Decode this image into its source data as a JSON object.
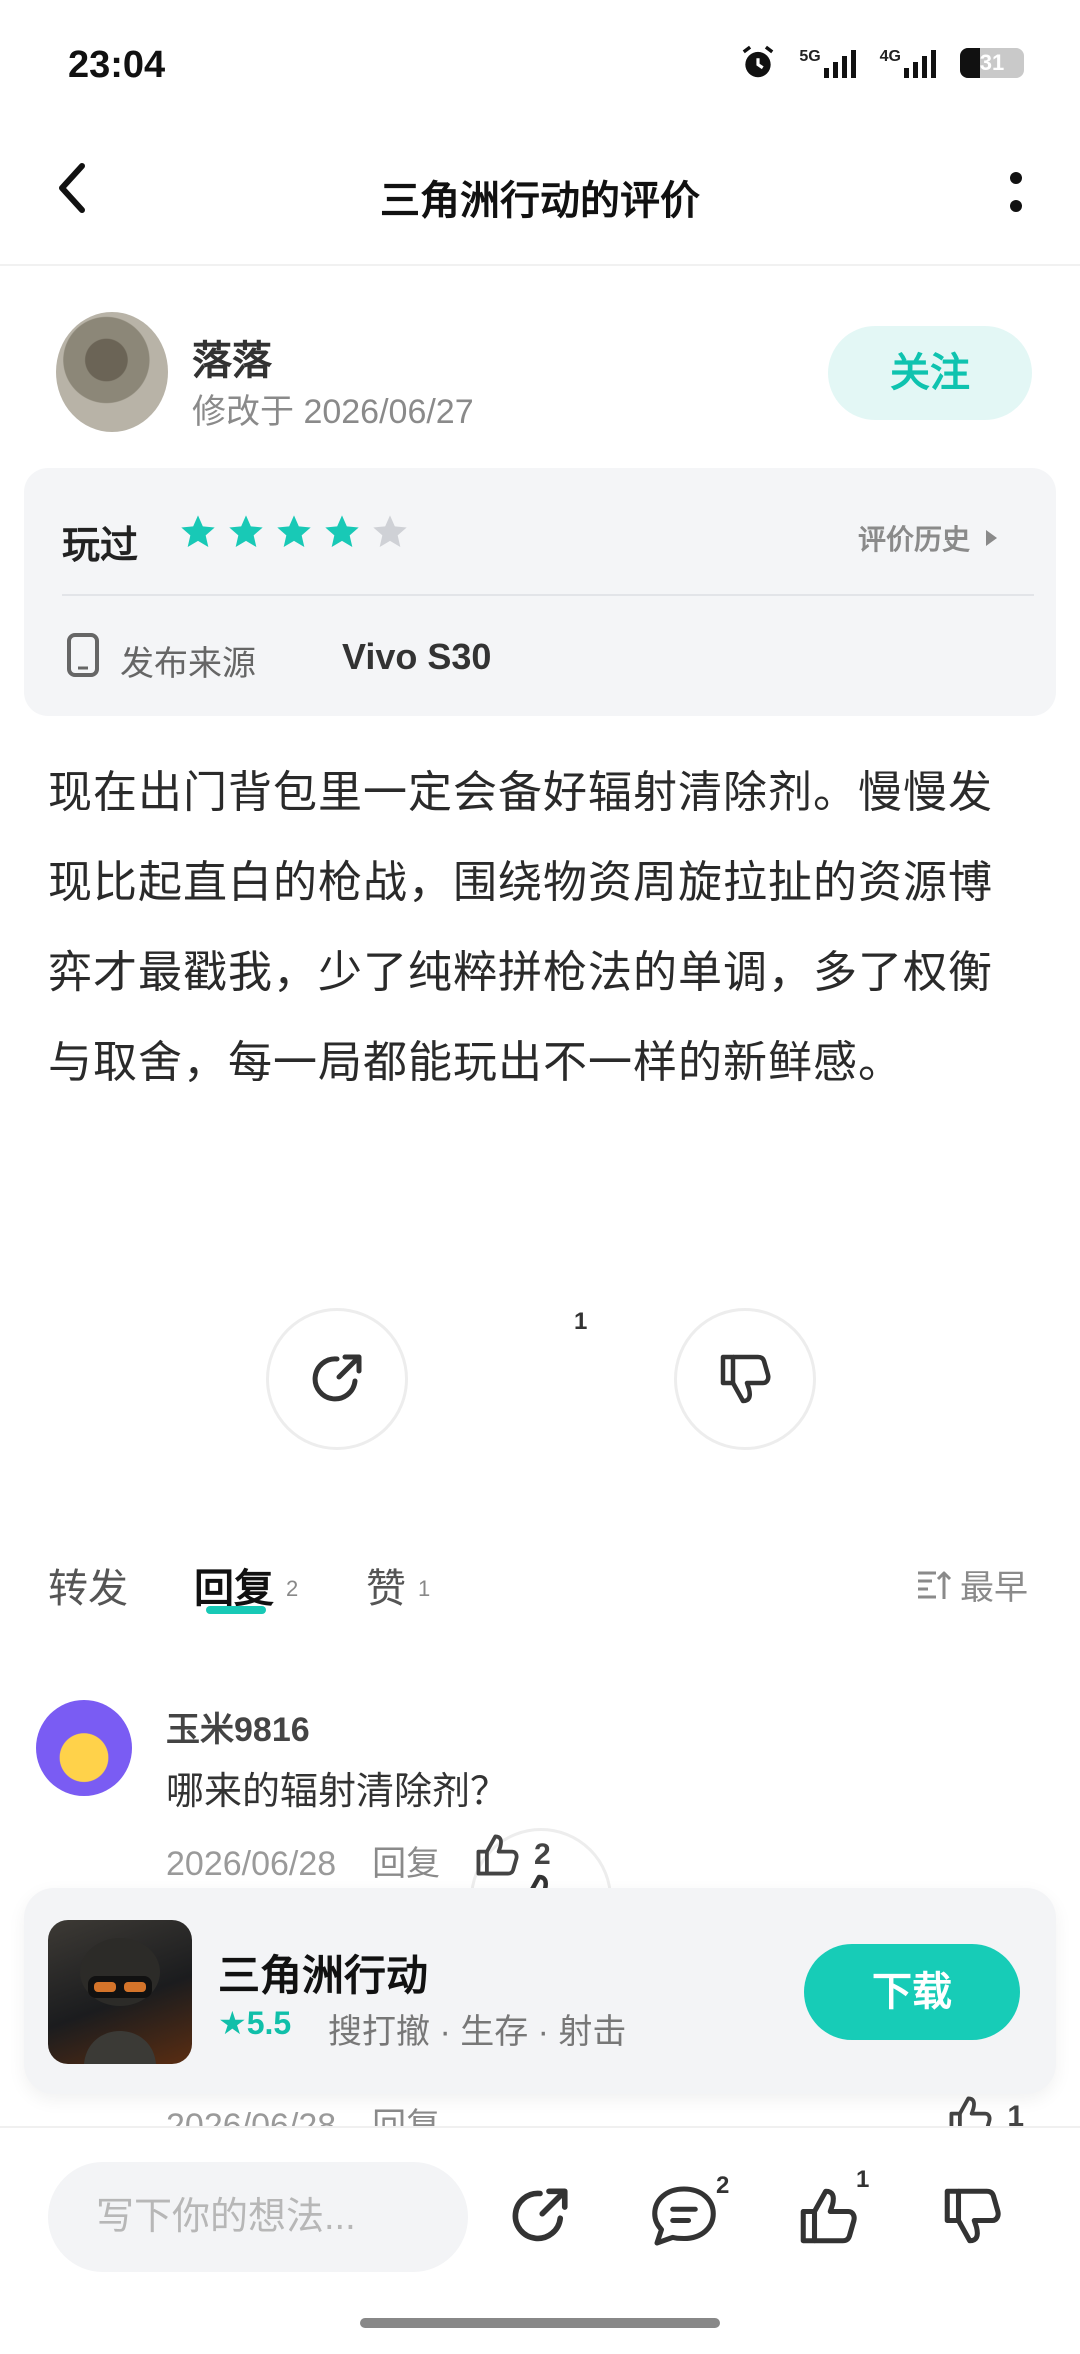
{
  "status": {
    "time": "23:04",
    "battery": "31",
    "net1": "5G",
    "net2": "4G"
  },
  "header": {
    "title": "三角洲行动的评价"
  },
  "user": {
    "name": "落落",
    "modified": "修改于 2026/06/27",
    "follow_label": "关注"
  },
  "rating": {
    "played_label": "玩过",
    "stars_filled": 4,
    "stars_total": 5,
    "history_label": "评价历史",
    "source_label": "发布来源",
    "source_value": "Vivo S30",
    "accent": "#18c9b6"
  },
  "review": {
    "text": "现在出门背包里一定会备好辐射清除剂。慢慢发现比起直白的枪战，围绕物资周旋拉扯的资源博弈才最戳我，少了纯粹拼枪法的单调，多了权衡与取舍，每一局都能玩出不一样的新鲜感。"
  },
  "actions": {
    "like_count": "1"
  },
  "tabs": {
    "forward": "转发",
    "reply": "回复",
    "reply_count": "2",
    "like": "赞",
    "like_count": "1",
    "sort": "最早"
  },
  "comments": [
    {
      "name": "玉米9816",
      "text": "哪来的辐射清除剂？",
      "date": "2026/06/28",
      "reply": "回复",
      "likes": "2"
    },
    {
      "date": "2026/06/28",
      "reply": "回复",
      "likes": "1"
    }
  ],
  "game": {
    "name": "三角洲行动",
    "rating": "5.5",
    "tags": "搜打撤 · 生存 · 射击",
    "download_label": "下载"
  },
  "bottom": {
    "placeholder": "写下你的想法...",
    "comment_badge": "2",
    "like_badge": "1"
  }
}
